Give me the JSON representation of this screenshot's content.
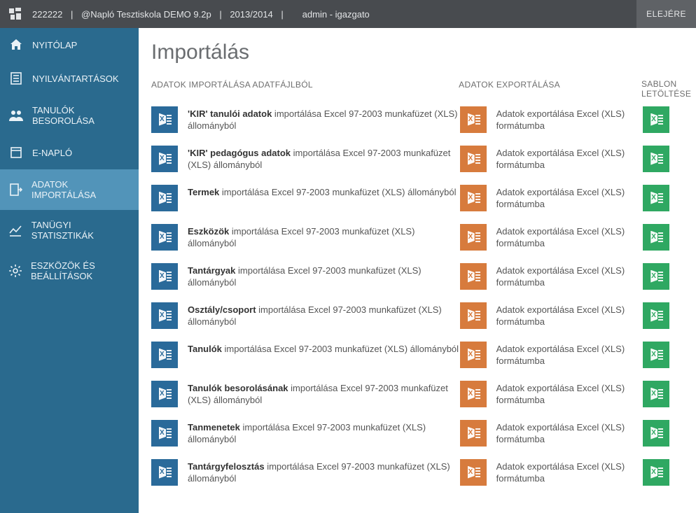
{
  "topbar": {
    "crumb1": "222222",
    "crumb2": "@Napló Tesztiskola DEMO 9.2p",
    "crumb3": "2013/2014",
    "crumb4": "admin - igazgato",
    "sep": "|",
    "right_button": "ELEJÉRE"
  },
  "sidebar": {
    "items": [
      {
        "label": "NYITÓLAP",
        "icon": "home-icon"
      },
      {
        "label": "NYILVÁNTARTÁSOK",
        "icon": "records-icon"
      },
      {
        "label": "TANULÓK BESOROLÁSA",
        "icon": "students-icon"
      },
      {
        "label": "E-NAPLÓ",
        "icon": "book-icon"
      },
      {
        "label": "ADATOK IMPORTÁLÁSA",
        "icon": "import-icon",
        "active": true
      },
      {
        "label": "TANÜGYI STATISZTIKÁK",
        "icon": "chart-icon"
      },
      {
        "label": "ESZKÖZÖK ÉS BEÁLLÍTÁSOK",
        "icon": "gear-icon"
      }
    ]
  },
  "page": {
    "title": "Importálás"
  },
  "columns": {
    "import": "ADATOK IMPORTÁLÁSA ADATFÁJLBÓL",
    "export": "ADATOK EXPORTÁLÁSA",
    "download": "SABLON LETÖLTÉSE"
  },
  "export_text": "Adatok exportálása Excel (XLS) formátumba",
  "rows": [
    {
      "bold": "'KIR' tanulói adatok",
      "rest": " importálása Excel 97-2003 munkafüzet (XLS) állományból"
    },
    {
      "bold": "'KIR' pedagógus adatok",
      "rest": " importálása Excel 97-2003 munkafüzet (XLS) állományból"
    },
    {
      "bold": "Termek",
      "rest": " importálása Excel 97-2003 munkafüzet (XLS) állományból"
    },
    {
      "bold": "Eszközök",
      "rest": " importálása Excel 97-2003 munkafüzet (XLS) állományból"
    },
    {
      "bold": "Tantárgyak",
      "rest": " importálása Excel 97-2003 munkafüzet (XLS) állományból"
    },
    {
      "bold": "Osztály/csoport",
      "rest": " importálása Excel 97-2003 munkafüzet (XLS) állományból"
    },
    {
      "bold": "Tanulók",
      "rest": " importálása Excel 97-2003 munkafüzet (XLS) állományból"
    },
    {
      "bold": "Tanulók besorolásának",
      "rest": " importálása Excel 97-2003 munkafüzet (XLS) állományból"
    },
    {
      "bold": "Tanmenetek",
      "rest": " importálása Excel 97-2003 munkafüzet (XLS) állományból"
    },
    {
      "bold": "Tantárgyfelosztás",
      "rest": " importálása Excel 97-2003 munkafüzet (XLS) állományból"
    }
  ]
}
